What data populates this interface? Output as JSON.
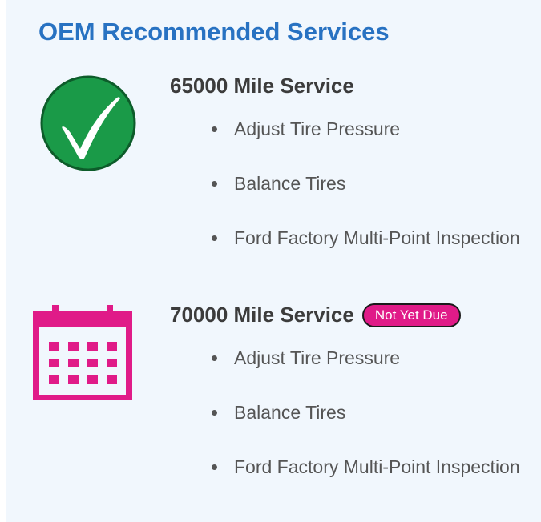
{
  "header": {
    "title": "OEM Recommended Services"
  },
  "colors": {
    "accent": "#2872c2",
    "completed": "#1a9a48",
    "pending": "#e01b88",
    "panel_background": "#f1f7fd"
  },
  "services": [
    {
      "title": "65000 Mile Service",
      "status_icon": "checkmark-icon",
      "badge": "",
      "items": [
        "Adjust Tire Pressure",
        "Balance Tires",
        "Ford Factory Multi-Point Inspection"
      ]
    },
    {
      "title": "70000 Mile Service",
      "status_icon": "calendar-icon",
      "badge": "Not Yet Due",
      "items": [
        "Adjust Tire Pressure",
        "Balance Tires",
        "Ford Factory Multi-Point Inspection"
      ]
    }
  ]
}
